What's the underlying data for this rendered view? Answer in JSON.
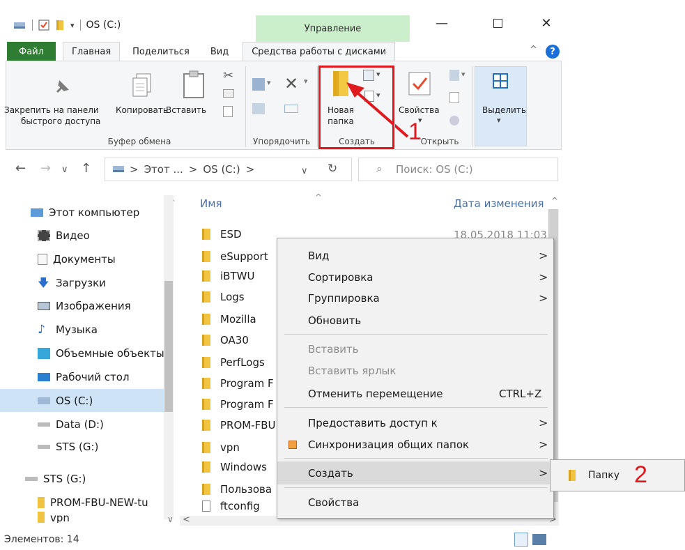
{
  "window": {
    "title": "OS (C:)",
    "context_tab_title": "Управление"
  },
  "tabs": [
    {
      "label": "Файл"
    },
    {
      "label": "Главная"
    },
    {
      "label": "Поделиться"
    },
    {
      "label": "Вид"
    },
    {
      "label": "Средства работы с дисками"
    }
  ],
  "ribbon": {
    "pin_label_1": "Закрепить на панели",
    "pin_label_2": "быстрого доступа",
    "copy_label": "Копировать",
    "paste_label": "Вставить",
    "clipboard_group": "Буфер обмена",
    "organize_group": "Упорядочить",
    "new_folder_1": "Новая",
    "new_folder_2": "папка",
    "create_group": "Создать",
    "properties_label": "Свойства",
    "open_group": "Открыть",
    "select_label": "Выделить"
  },
  "address": {
    "part1": "Этот ...",
    "part2": "OS (C:)",
    "sep": ">"
  },
  "search": {
    "placeholder": "Поиск: OS (C:)"
  },
  "nav": [
    {
      "label": "Этот компьютер",
      "icon": "computer"
    },
    {
      "label": "Видео",
      "icon": "video"
    },
    {
      "label": "Документы",
      "icon": "documents"
    },
    {
      "label": "Загрузки",
      "icon": "downloads"
    },
    {
      "label": "Изображения",
      "icon": "images"
    },
    {
      "label": "Музыка",
      "icon": "music"
    },
    {
      "label": "Объемные объекты",
      "icon": "3d-objects"
    },
    {
      "label": "Рабочий стол",
      "icon": "desktop"
    },
    {
      "label": "OS (C:)",
      "icon": "drive"
    },
    {
      "label": "Data (D:)",
      "icon": "drive"
    },
    {
      "label": "STS (G:)",
      "icon": "drive"
    },
    {
      "label": "STS (G:)",
      "icon": "drive"
    },
    {
      "label": "PROM-FBU-NEW-tu",
      "icon": "folder"
    },
    {
      "label": "vpn",
      "icon": "folder"
    }
  ],
  "columns": {
    "name": "Имя",
    "date": "Дата изменения"
  },
  "files": [
    {
      "name": "ESD",
      "date": "18.05.2018 11:03"
    },
    {
      "name": "eSupport"
    },
    {
      "name": "iBTWU"
    },
    {
      "name": "Logs"
    },
    {
      "name": "Mozilla"
    },
    {
      "name": "OA30"
    },
    {
      "name": "PerfLogs"
    },
    {
      "name": "Program F"
    },
    {
      "name": "Program F"
    },
    {
      "name": "PROM-FBU"
    },
    {
      "name": "vpn"
    },
    {
      "name": "Windows"
    },
    {
      "name": "Пользова"
    },
    {
      "name": "ftconfig"
    }
  ],
  "status": {
    "count": "Элементов: 14"
  },
  "menu": {
    "view": "Вид",
    "sort": "Сортировка",
    "group": "Группировка",
    "refresh": "Обновить",
    "paste": "Вставить",
    "paste_shortcut": "Вставить ярлык",
    "undo_move": "Отменить перемещение",
    "undo_shortcut": "CTRL+Z",
    "share": "Предоставить доступ к",
    "sync": "Синхронизация общих папок",
    "create": "Создать",
    "properties": "Свойства"
  },
  "submenu": {
    "folder": "Папку"
  },
  "annotations": {
    "one": "1",
    "two": "2"
  },
  "colors": {
    "file_tab": "#2f7d32",
    "context_tab": "#cbeecb",
    "annotation": "#e0191f",
    "selection": "#cfe3f7"
  }
}
